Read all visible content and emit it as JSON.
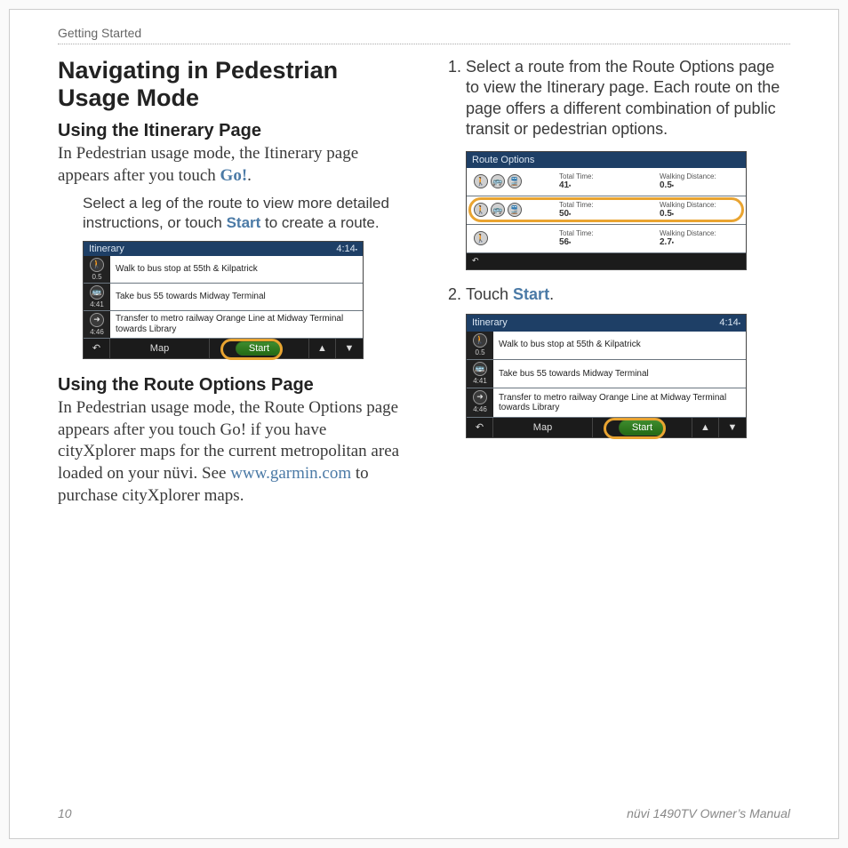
{
  "header": {
    "crumb": "Getting Started"
  },
  "title": "Navigating in Pedestrian Usage Mode",
  "left": {
    "subhead1": "Using the Itinerary Page",
    "para1_a": "In Pedestrian usage mode, the Itinerary page appears after you touch ",
    "para1_go": "Go!",
    "para1_b": ".",
    "indent1_a": "Select a leg of the route to view more detailed instructions, or touch ",
    "indent1_start": "Start",
    "indent1_b": " to create a route.",
    "subhead2": "Using the Route Options Page",
    "para2_a": "In Pedestrian usage mode, the Route Options page appears after you touch Go! if you have cityXplorer maps for the current metropolitan area loaded on your nüvi. See ",
    "para2_link": "www.garmin.com",
    "para2_b": " to purchase cityXplorer maps."
  },
  "right": {
    "step1": "Select a route from the Route Options page to view the Itinerary page. Each route on the page offers a different combination of public transit or pedestrian options.",
    "step2_a": "Touch ",
    "step2_start": "Start",
    "step2_b": "."
  },
  "itinerary_widget": {
    "title": "Itinerary",
    "clock": "4:14",
    "legs": [
      {
        "icon": "walk",
        "sub": "0.5",
        "text": "Walk to bus stop at 55th & Kilpatrick"
      },
      {
        "icon": "bus",
        "sub": "4:41",
        "text": "Take bus 55 towards Midway Terminal"
      },
      {
        "icon": "transfer",
        "sub": "4:46",
        "text": "Transfer to metro railway Orange Line at Midway Terminal towards Library"
      }
    ],
    "map_label": "Map",
    "start_label": "Start"
  },
  "route_widget": {
    "title": "Route Options",
    "total_time_label": "Total Time:",
    "walk_dist_label": "Walking Distance:",
    "rows": [
      {
        "icons": [
          "walk",
          "bus",
          "train"
        ],
        "time": "41",
        "dist": "0.5"
      },
      {
        "icons": [
          "walk",
          "bus",
          "train"
        ],
        "time": "50",
        "dist": "0.5",
        "highlighted": true
      },
      {
        "icons": [
          "walk"
        ],
        "time": "56",
        "dist": "2.7"
      }
    ]
  },
  "footer": {
    "page": "10",
    "manual": "nüvi 1490TV Owner’s Manual"
  },
  "icons": {
    "walk": "🚶",
    "bus": "🚌",
    "train": "🚆",
    "transfer": "➜",
    "back": "↶",
    "up": "▲",
    "down": "▼"
  }
}
